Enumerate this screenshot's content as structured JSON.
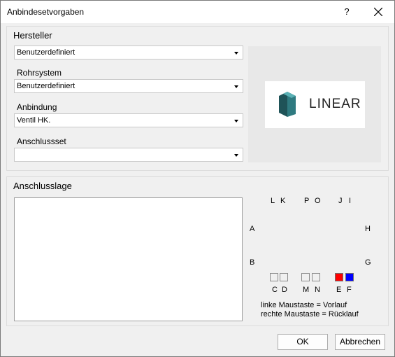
{
  "window": {
    "title": "Anbindesetvorgaben",
    "help": "?",
    "close_icon": "close-icon"
  },
  "hersteller": {
    "group_title": "Hersteller",
    "manufacturer_value": "Benutzerdefiniert",
    "rohrsystem_label": "Rohrsystem",
    "rohrsystem_value": "Benutzerdefiniert",
    "anbindung_label": "Anbindung",
    "anbindung_value": "Ventil HK.",
    "anschlussset_label": "Anschlussset",
    "anschlussset_value": "",
    "logo_text": "LINEAR"
  },
  "anschlusslage": {
    "group_title": "Anschlusslage",
    "positions": {
      "L": "L",
      "K": "K",
      "P": "P",
      "O": "O",
      "J": "J",
      "I": "I",
      "A": "A",
      "H": "H",
      "B": "B",
      "G": "G",
      "C": "C",
      "D": "D",
      "M": "M",
      "N": "N",
      "E": "E",
      "F": "F"
    },
    "colors": {
      "vorlauf": "#ff0000",
      "ruecklauf": "#0000ff"
    },
    "hint_left": "linke Maustaste = Vorlauf",
    "hint_right": "rechte Maustaste = Rücklauf"
  },
  "buttons": {
    "ok": "OK",
    "cancel": "Abbrechen"
  }
}
